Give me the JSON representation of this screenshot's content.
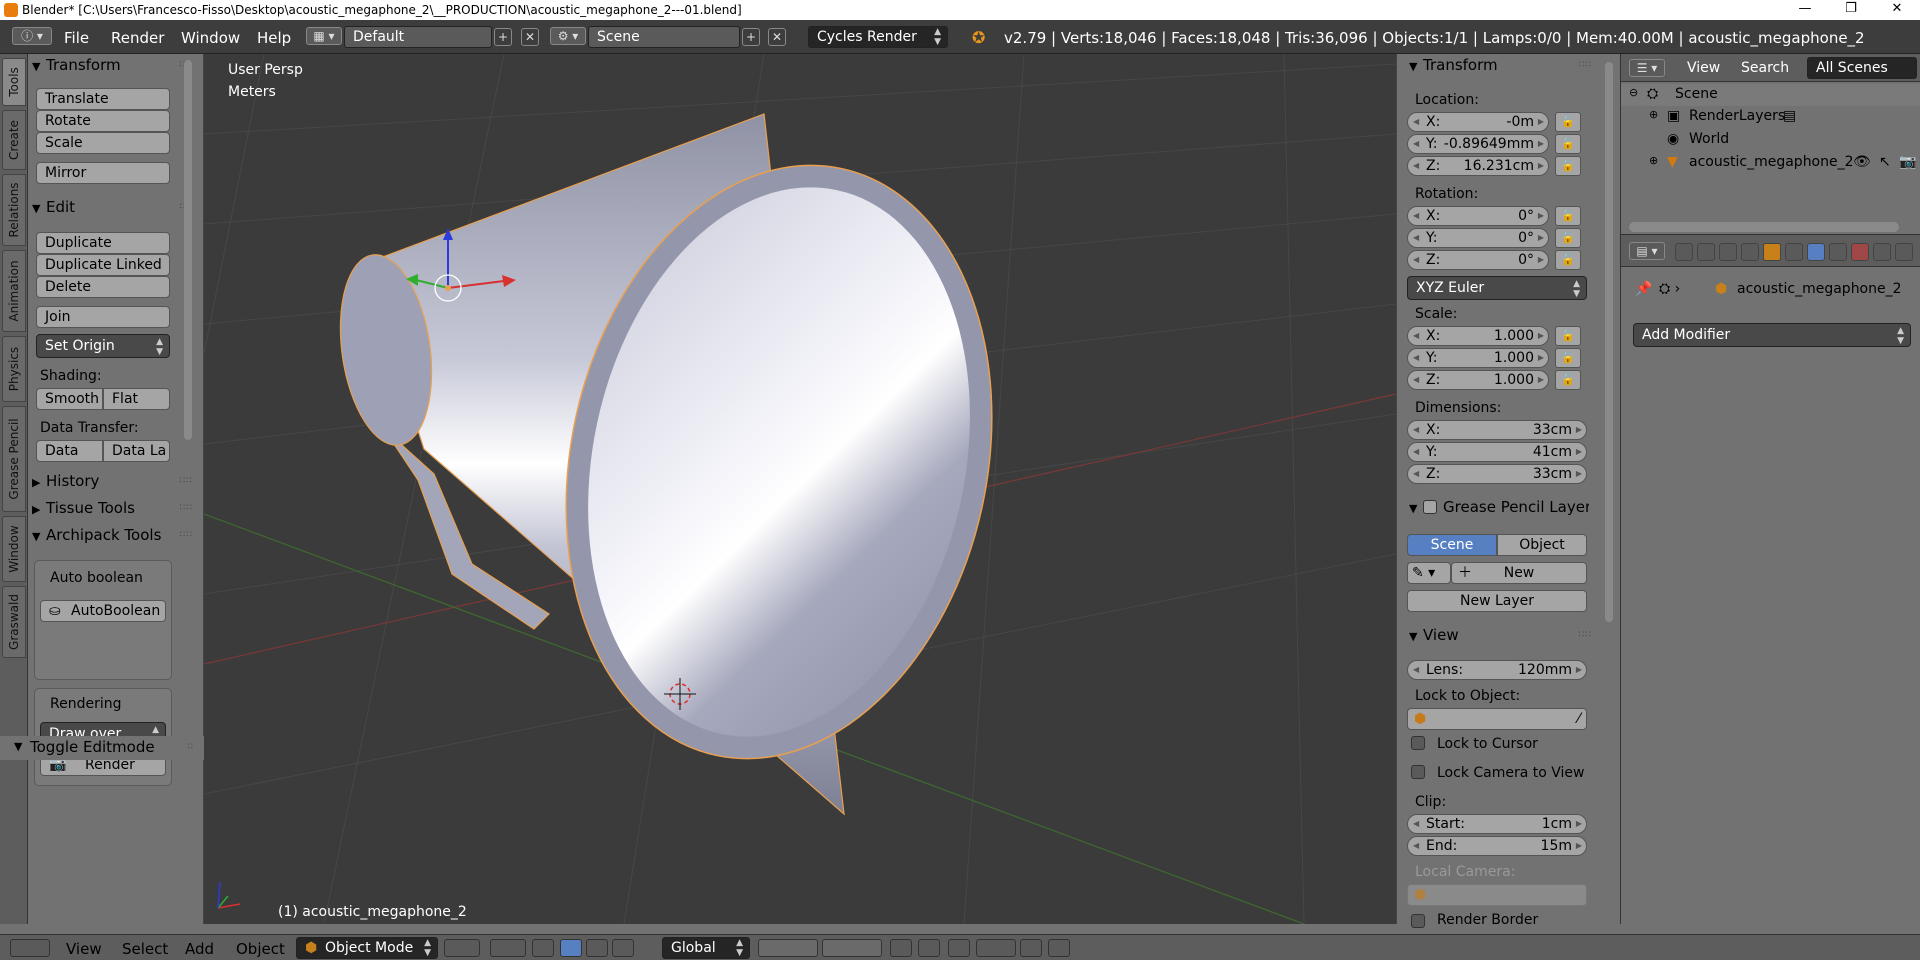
{
  "window": {
    "title": "Blender* [C:\\Users\\Francesco-Fisso\\Desktop\\acoustic_megaphone_2\\__PRODUCTION\\acoustic_megaphone_2---01.blend]",
    "controls": [
      "—",
      "❐",
      "✕"
    ]
  },
  "topbar": {
    "menus": [
      "File",
      "Render",
      "Window",
      "Help"
    ],
    "layout": "Default",
    "scene": "Scene",
    "engine": "Cycles Render",
    "stats": "v2.79 | Verts:18,046 | Faces:18,048 | Tris:36,096 | Objects:1/1 | Lamps:0/0 | Mem:40.00M | acoustic_megaphone_2"
  },
  "lefttabs": [
    "Tools",
    "Create",
    "Relations",
    "Animation",
    "Physics",
    "Grease Pencil",
    "Window",
    "Graswald"
  ],
  "toolshelf": {
    "transform": {
      "title": "Transform",
      "buttons": [
        "Translate",
        "Rotate",
        "Scale",
        "Mirror"
      ]
    },
    "edit": {
      "title": "Edit",
      "buttons": [
        "Duplicate",
        "Duplicate Linked",
        "Delete",
        "Join"
      ],
      "set_origin": "Set Origin"
    },
    "shading": {
      "label": "Shading:",
      "smooth": "Smooth",
      "flat": "Flat"
    },
    "data_transfer": {
      "label": "Data Transfer:",
      "data": "Data",
      "data_la": "Data La"
    },
    "history": "History",
    "tissue": "Tissue Tools",
    "archipack": "Archipack Tools",
    "auto_boolean": {
      "label": "Auto boolean",
      "button": "AutoBoolean"
    },
    "rendering": {
      "label": "Rendering",
      "draw_over": "Draw over",
      "render": "Render"
    },
    "toggle_editmode": "Toggle Editmode"
  },
  "viewport": {
    "view_name": "User Persp",
    "units": "Meters",
    "object_label": "(1) acoustic_megaphone_2"
  },
  "npanel": {
    "transform_title": "Transform",
    "location_label": "Location:",
    "location": [
      {
        "axis": "X:",
        "value": "-0m"
      },
      {
        "axis": "Y:",
        "value": "-0.89649mm"
      },
      {
        "axis": "Z:",
        "value": "16.231cm"
      }
    ],
    "rotation_label": "Rotation:",
    "rotation": [
      {
        "axis": "X:",
        "value": "0°"
      },
      {
        "axis": "Y:",
        "value": "0°"
      },
      {
        "axis": "Z:",
        "value": "0°"
      }
    ],
    "rotation_mode": "XYZ Euler",
    "scale_label": "Scale:",
    "scale": [
      {
        "axis": "X:",
        "value": "1.000"
      },
      {
        "axis": "Y:",
        "value": "1.000"
      },
      {
        "axis": "Z:",
        "value": "1.000"
      }
    ],
    "dimensions_label": "Dimensions:",
    "dimensions": [
      {
        "axis": "X:",
        "value": "33cm"
      },
      {
        "axis": "Y:",
        "value": "41cm"
      },
      {
        "axis": "Z:",
        "value": "33cm"
      }
    ],
    "grease_title": "Grease Pencil Layer",
    "grease_scene": "Scene",
    "grease_object": "Object",
    "grease_new": "New",
    "grease_new_layer": "New Layer",
    "view_title": "View",
    "lens_label": "Lens:",
    "lens_value": "120mm",
    "lock_to_object": "Lock to Object:",
    "lock_to_cursor": "Lock to Cursor",
    "lock_camera": "Lock Camera to View",
    "clip_label": "Clip:",
    "clip_start_label": "Start:",
    "clip_start": "1cm",
    "clip_end_label": "End:",
    "clip_end": "15m",
    "local_camera": "Local Camera:",
    "render_border": "Render Border"
  },
  "outliner": {
    "view": "View",
    "search": "Search",
    "all_scenes": "All Scenes",
    "rows": [
      "Scene",
      "RenderLayers",
      "World",
      "acoustic_megaphone_2"
    ]
  },
  "properties": {
    "object_name": "acoustic_megaphone_2",
    "add_modifier": "Add Modifier"
  },
  "bottombar": {
    "menus": [
      "View",
      "Select",
      "Add",
      "Object"
    ],
    "mode": "Object Mode",
    "orientation": "Global"
  }
}
